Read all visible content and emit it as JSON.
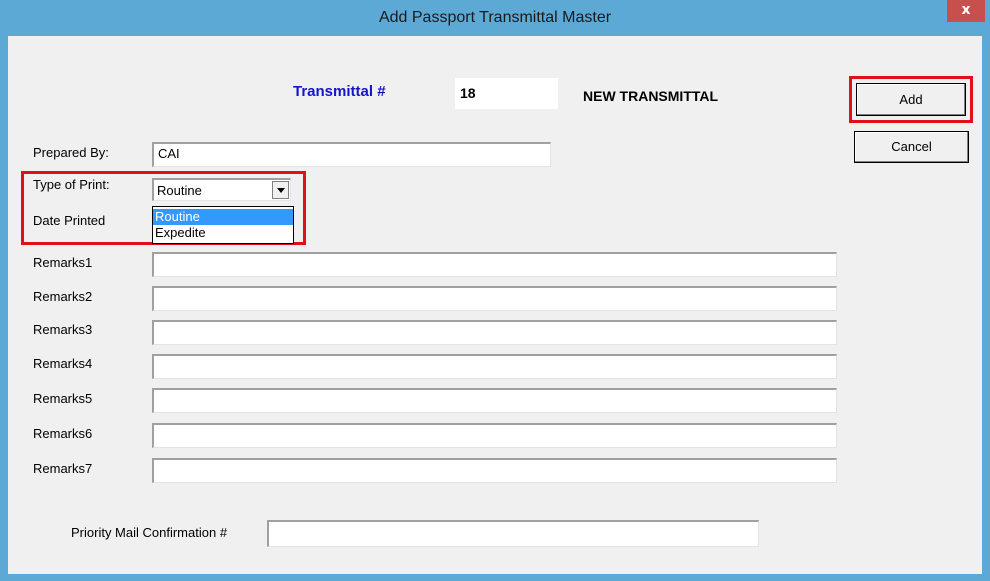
{
  "window": {
    "title": "Add Passport Transmittal Master",
    "close_label": "x"
  },
  "header": {
    "transmittal_label": "Transmittal #",
    "transmittal_number": "18",
    "status": "NEW TRANSMITTAL"
  },
  "buttons": {
    "add": "Add",
    "cancel": "Cancel"
  },
  "form": {
    "prepared_by": {
      "label": "Prepared By:",
      "value": "CAI"
    },
    "type_of_print": {
      "label": "Type of Print:",
      "value": "Routine",
      "options": [
        "Routine",
        "Expedite"
      ],
      "highlighted": "Routine"
    },
    "date_printed": {
      "label": "Date Printed"
    },
    "remarks": [
      {
        "label": "Remarks1",
        "value": ""
      },
      {
        "label": "Remarks2",
        "value": ""
      },
      {
        "label": "Remarks3",
        "value": ""
      },
      {
        "label": "Remarks4",
        "value": ""
      },
      {
        "label": "Remarks5",
        "value": ""
      },
      {
        "label": "Remarks6",
        "value": ""
      },
      {
        "label": "Remarks7",
        "value": ""
      }
    ],
    "priority_mail": {
      "label": "Priority Mail Confirmation #",
      "value": ""
    }
  },
  "colors": {
    "titlebar": "#5da9d6",
    "highlight_box": "#e0101a",
    "label_blue": "#1414c8",
    "selected_option": "#3399ff"
  }
}
